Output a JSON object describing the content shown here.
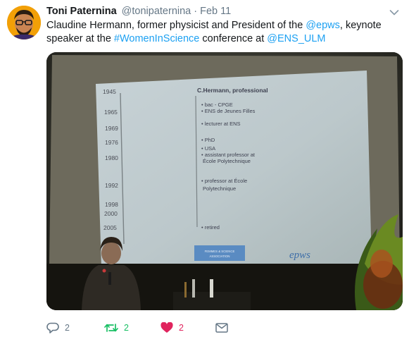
{
  "tweet": {
    "author_name": "Toni Paternina",
    "handle": "@tonipaternina",
    "separator": "·",
    "date": "Feb 11",
    "text_parts": {
      "p1": "Claudine Hermann, former physicist and President of the ",
      "mention1": "@epws",
      "p2": ", keynote speaker at the ",
      "hashtag": "#WomenInScience",
      "p3": " conference at ",
      "mention2": "@ENS_ULM"
    }
  },
  "slide": {
    "title": "C.Hermann, professional",
    "years": [
      "1945",
      "1965",
      "1969",
      "1976",
      "1980",
      "1992",
      "1998",
      "2000",
      "2005"
    ],
    "notes": {
      "n1": "• bac - CPGE",
      "n2": "• ENS de Jeunes Filles",
      "n3": "• lecturer at ENS",
      "n4": "• PhD",
      "n5": "• USA",
      "n6": "• assistant professor at",
      "n7": "École Polytechnique",
      "n8": "• professor at École",
      "n9": "Polytechnique",
      "n10": "• retired"
    },
    "logo_left_line1": "FEMMES & SCIENCE",
    "logo_left_line2": "ASSOCIATION",
    "logo_right": "epws"
  },
  "actions": {
    "reply_count": "2",
    "retweet_count": "2",
    "like_count": "2"
  },
  "colors": {
    "accent_link": "#1da1f2",
    "retweet": "#17bf63",
    "like": "#e0245e",
    "muted": "#657786"
  },
  "icons": [
    "reply-icon",
    "retweet-icon",
    "like-icon",
    "direct-message-icon",
    "caret-down-icon"
  ]
}
